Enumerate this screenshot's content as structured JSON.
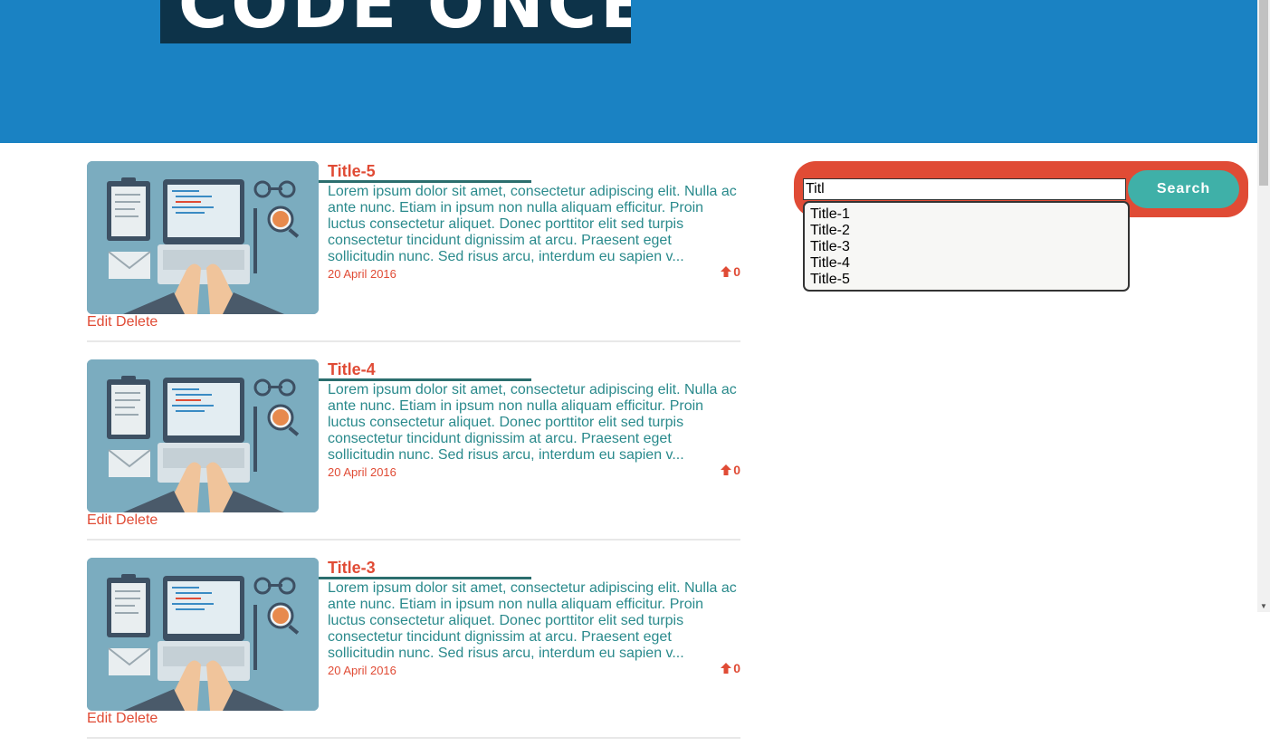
{
  "header": {
    "banner_text": "CODE ONCE!"
  },
  "posts": [
    {
      "title": "Title-5",
      "excerpt": "Lorem ipsum dolor sit amet, consectetur adipiscing elit. Nulla ac ante nunc. Etiam in ipsum non nulla aliquam efficitur. Proin luctus consectetur aliquet. Donec porttitor elit sed turpis consectetur tincidunt dignissim at arcu. Praesent eget sollicitudin nunc. Sed risus arcu, interdum eu sapien v...",
      "date": "20 April 2016",
      "votes": "0",
      "edit_label": "Edit",
      "delete_label": "Delete"
    },
    {
      "title": "Title-4",
      "excerpt": "Lorem ipsum dolor sit amet, consectetur adipiscing elit. Nulla ac ante nunc. Etiam in ipsum non nulla aliquam efficitur. Proin luctus consectetur aliquet. Donec porttitor elit sed turpis consectetur tincidunt dignissim at arcu. Praesent eget sollicitudin nunc. Sed risus arcu, interdum eu sapien v...",
      "date": "20 April 2016",
      "votes": "0",
      "edit_label": "Edit",
      "delete_label": "Delete"
    },
    {
      "title": "Title-3",
      "excerpt": "Lorem ipsum dolor sit amet, consectetur adipiscing elit. Nulla ac ante nunc. Etiam in ipsum non nulla aliquam efficitur. Proin luctus consectetur aliquet. Donec porttitor elit sed turpis consectetur tincidunt dignissim at arcu. Praesent eget sollicitudin nunc. Sed risus arcu, interdum eu sapien v...",
      "date": "20 April 2016",
      "votes": "0",
      "edit_label": "Edit",
      "delete_label": "Delete"
    }
  ],
  "search": {
    "value": "Titl",
    "button_label": "Search",
    "suggestions": [
      "Title-1",
      "Title-2",
      "Title-3",
      "Title-4",
      "Title-5"
    ]
  },
  "icons": {
    "upvote": "arrow-up-icon",
    "post_thumbnail": "laptop-workspace-illustration"
  },
  "colors": {
    "header": "#1a82c3",
    "accent": "#e04b35",
    "teal": "#3fb0a8",
    "text": "#2a8a8c"
  }
}
